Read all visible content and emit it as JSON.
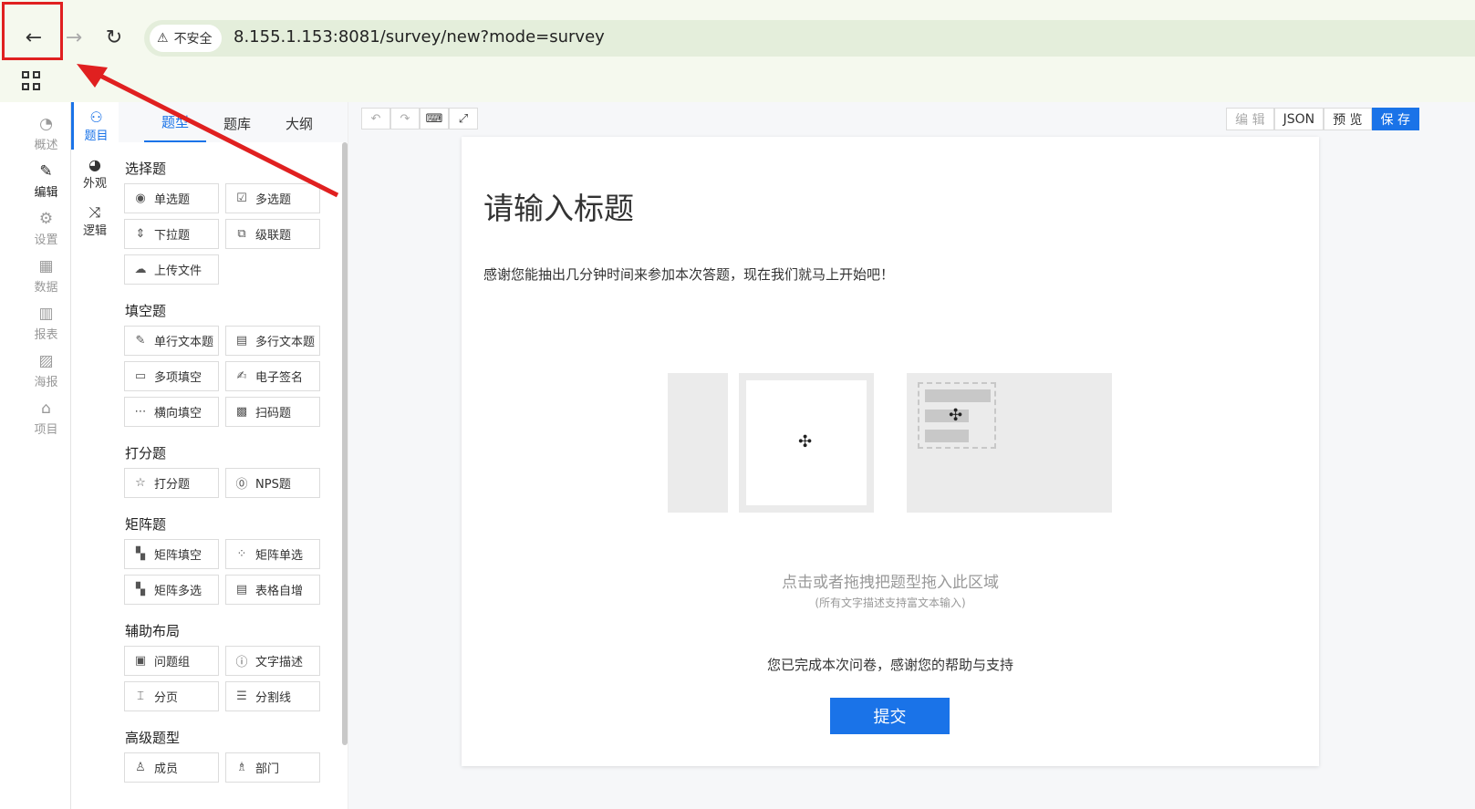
{
  "browser": {
    "back_icon": "←",
    "forward_icon": "→",
    "reload_icon": "↻",
    "security_icon": "⚠",
    "security_label": "不安全",
    "url": "8.155.1.153:8081/survey/new?mode=survey",
    "apps_icon": "grid-icon"
  },
  "left_rail": {
    "items": [
      {
        "icon": "◔",
        "label": "概述"
      },
      {
        "icon": "✎",
        "label": "编辑"
      },
      {
        "icon": "⚙",
        "label": "设置"
      },
      {
        "icon": "▦",
        "label": "数据"
      },
      {
        "icon": "▥",
        "label": "报表"
      },
      {
        "icon": "▨",
        "label": "海报"
      },
      {
        "icon": "⌂",
        "label": "项目"
      }
    ],
    "active": "编辑"
  },
  "tool_rail": {
    "items": [
      {
        "icon": "⚇",
        "label": "题目"
      },
      {
        "icon": "◕",
        "label": "外观"
      },
      {
        "icon": "⤨",
        "label": "逻辑"
      }
    ],
    "active": "题目"
  },
  "panel": {
    "tabs": [
      "题型",
      "题库",
      "大纲"
    ],
    "active_tab": "题型",
    "groups": [
      {
        "title": "选择题",
        "items": [
          {
            "icon": "◉",
            "label": "单选题"
          },
          {
            "icon": "☑",
            "label": "多选题"
          },
          {
            "icon": "⇕",
            "label": "下拉题"
          },
          {
            "icon": "⧉",
            "label": "级联题"
          },
          {
            "icon": "☁",
            "label": "上传文件"
          }
        ]
      },
      {
        "title": "填空题",
        "items": [
          {
            "icon": "✎",
            "label": "单行文本题"
          },
          {
            "icon": "▤",
            "label": "多行文本题"
          },
          {
            "icon": "▭",
            "label": "多项填空"
          },
          {
            "icon": "✍",
            "label": "电子签名"
          },
          {
            "icon": "⋯",
            "label": "横向填空"
          },
          {
            "icon": "▩",
            "label": "扫码题"
          }
        ]
      },
      {
        "title": "打分题",
        "items": [
          {
            "icon": "☆",
            "label": "打分题"
          },
          {
            "icon": "⓪",
            "label": "NPS题"
          }
        ]
      },
      {
        "title": "矩阵题",
        "items": [
          {
            "icon": "▚",
            "label": "矩阵填空"
          },
          {
            "icon": "⁘",
            "label": "矩阵单选"
          },
          {
            "icon": "▚",
            "label": "矩阵多选"
          },
          {
            "icon": "▤",
            "label": "表格自增"
          }
        ]
      },
      {
        "title": "辅助布局",
        "items": [
          {
            "icon": "▣",
            "label": "问题组"
          },
          {
            "icon": "ⓘ",
            "label": "文字描述"
          },
          {
            "icon": "⌶",
            "label": "分页"
          },
          {
            "icon": "☰",
            "label": "分割线"
          }
        ]
      },
      {
        "title": "高级题型",
        "items": [
          {
            "icon": "♙",
            "label": "成员"
          },
          {
            "icon": "♗",
            "label": "部门"
          }
        ]
      }
    ]
  },
  "toolbar": {
    "undo_icon": "↶",
    "redo_icon": "↷",
    "keyboard_icon": "⌨",
    "expand_icon": "⤢",
    "edit_label": "编 辑",
    "json_label": "JSON",
    "preview_label": "预 览",
    "save_label": "保 存"
  },
  "survey": {
    "title": "请输入标题",
    "description": "感谢您能抽出几分钟时间来参加本次答题，现在我们就马上开始吧！",
    "drop_hint": "点击或者拖拽把题型拖入此区域",
    "drop_subhint": "(所有文字描述支持富文本输入)",
    "finish_text": "您已完成本次问卷，感谢您的帮助与支持",
    "submit_label": "提交",
    "move_icon": "✣"
  },
  "colors": {
    "accent": "#1a73e8",
    "annotation": "#e02020"
  }
}
